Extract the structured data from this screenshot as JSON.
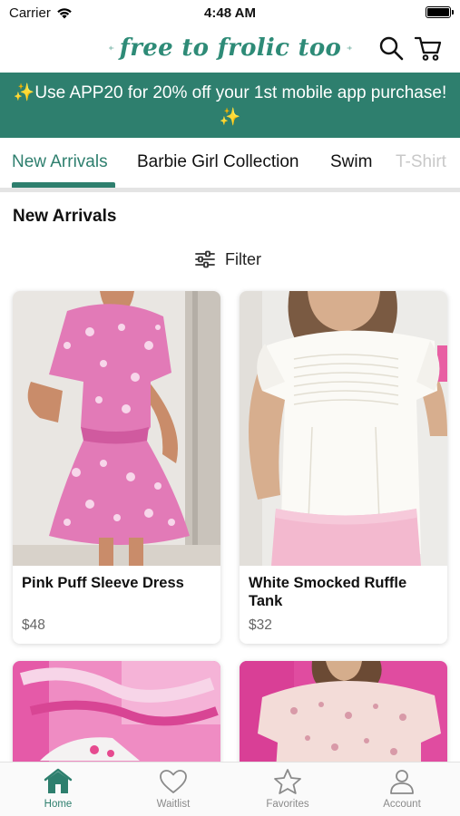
{
  "status_bar": {
    "carrier": "Carrier",
    "time": "4:48 AM"
  },
  "header": {
    "logo_text": "free to frolic too"
  },
  "promo": {
    "line1": "✨Use APP20 for 20% off your 1st mobile app purchase!",
    "line2": "✨"
  },
  "category_tabs": [
    {
      "label": "New Arrivals"
    },
    {
      "label": "Barbie Girl Collection"
    },
    {
      "label": "Swim"
    },
    {
      "label": "T-Shirt"
    }
  ],
  "section": {
    "title": "New Arrivals"
  },
  "filter": {
    "label": "Filter"
  },
  "products": [
    {
      "name": "Pink Puff Sleeve Dress",
      "price": "$48"
    },
    {
      "name": "White Smocked Ruffle Tank",
      "price": "$32"
    },
    {
      "name": "",
      "price": ""
    },
    {
      "name": "",
      "price": ""
    }
  ],
  "tab_bar": [
    {
      "label": "Home",
      "icon": "home-icon"
    },
    {
      "label": "Waitlist",
      "icon": "heart-icon"
    },
    {
      "label": "Favorites",
      "icon": "star-icon"
    },
    {
      "label": "Account",
      "icon": "person-icon"
    }
  ],
  "colors": {
    "brand": "#2e7f6e",
    "logo": "#2e8b77",
    "inactive": "#8a8a8a"
  }
}
